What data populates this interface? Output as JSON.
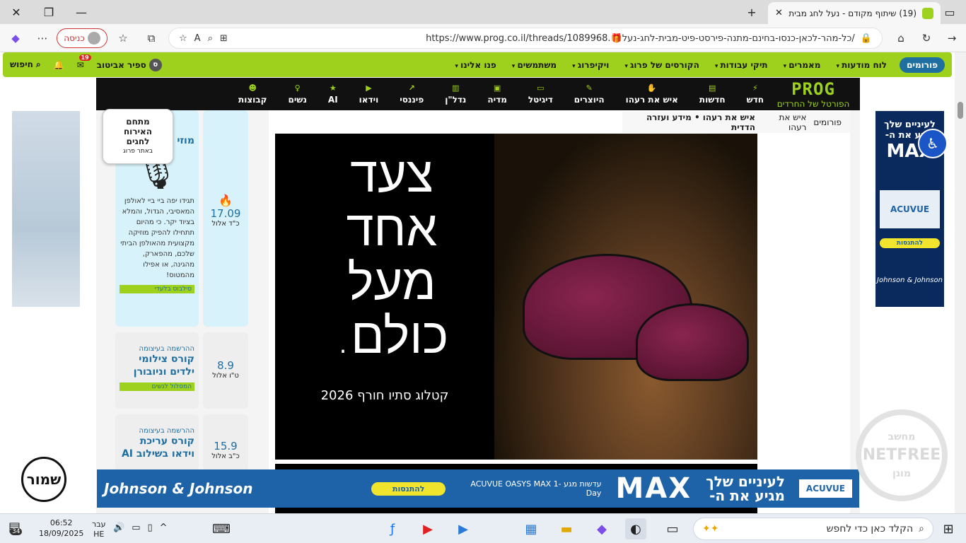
{
  "browser": {
    "tab_title": "(19) שיתוף מקודם - נעל לחג מבית",
    "tab_close": "✕",
    "new_tab": "+",
    "url": "https://www.prog.co.il/threads/1089968.🎁כל-מהר-לכאן-כנסו-בחינם-מתנה-פירסט-פיט-מבית-לחג-נעל/",
    "login_label": "כניסה",
    "close_btn": "✕",
    "restore_btn": "❐",
    "minimize_btn": "—"
  },
  "site": {
    "forums_label": "פורומים",
    "menu": [
      "לוח מודעות",
      "מאמרים",
      "תיקי עבודות",
      "הקורסים של פרוג",
      "ויקיפרוג",
      "משתמשים",
      "פנו אלינו"
    ],
    "notif_count": "19",
    "user_name": "ספיר אביטוב",
    "user_initial": "ס",
    "search_label": "חיפוש",
    "logo_text": "PROG",
    "logo_sub": "הפורטל של החרדים",
    "nav": [
      "חדש",
      "חדשות",
      "איש את רעהו",
      "היוצרים",
      "דיגיטל",
      "מדיה",
      "נדל\"ן",
      "פיננסי",
      "וידאו",
      "AI",
      "נשים",
      "קבוצות"
    ]
  },
  "breadcrumb": {
    "items": [
      "פורומים",
      "איש את רעהו",
      "איש את רעהו • מידע ועזרה הדדית"
    ]
  },
  "banner": {
    "headline_lines": [
      "צעד",
      "אחד",
      "מעל",
      "כולם."
    ],
    "catalog": "קטלוג סתיו חורף 2026"
  },
  "sticker": {
    "line1": "מתחם",
    "line2": "האירוח",
    "line3": "לחגים",
    "small": "באתר פרוג"
  },
  "sidebar": {
    "cards": [
      {
        "date": "17.09",
        "hebdate": "כ\"ד אלול",
        "sub": "",
        "title": "מוזי מהא",
        "body": "תגידו יפה ביי ביי לאולפן המאסיבי, הגדול, והמלא בציוד יקר. כי מהיום תתחילו להפיק מוזיקה מקצועית מהאולפן הביתי שלכם, מהפארק, מהגינה, או אפילו מהמטוס!",
        "tag": "סילבוס בלעדי"
      },
      {
        "date": "8.9",
        "hebdate": "ט\"ו אלול",
        "sub": "ההרשמה בעיצומה",
        "title": "קורס צילומי ילדים וניובורן",
        "body": "",
        "tag": "המסלול לנשים"
      },
      {
        "date": "15.9",
        "hebdate": "כ\"ב אלול",
        "sub": "ההרשמה בעיצומה",
        "title": "קורס עריכת וידאו בשילוב AI",
        "body": "",
        "tag": ""
      }
    ]
  },
  "ads": {
    "right_top": "לעיניים שלך מגיע את ה-",
    "right_max": "MAX",
    "right_brand": "ACUVUE",
    "right_btn": "להתנסות",
    "jj": "Johnson & Johnson",
    "bottom_btn": "להתנסות",
    "bottom_text1": "לעיניים שלך",
    "bottom_text2": "מגיע את ה-",
    "bottom_max": "MAX",
    "bottom_oasys": "עדשות מגע ACUVUE OASYS MAX 1-Day",
    "bottom_brand": "ACUVUE"
  },
  "netfree": {
    "label": "NETFREE",
    "top": "מחשב",
    "bottom": "מוגן"
  },
  "shamor": "שמור",
  "taskbar": {
    "search_placeholder": "הקלד כאן כדי לחפש",
    "time": "06:52",
    "date": "18/09/2025",
    "lang": "עבר",
    "lang2": "HE",
    "badge": "34"
  },
  "colors": {
    "brand_green": "#9ed11e",
    "brand_blue": "#1f6fa0",
    "nav_black": "#111111"
  }
}
